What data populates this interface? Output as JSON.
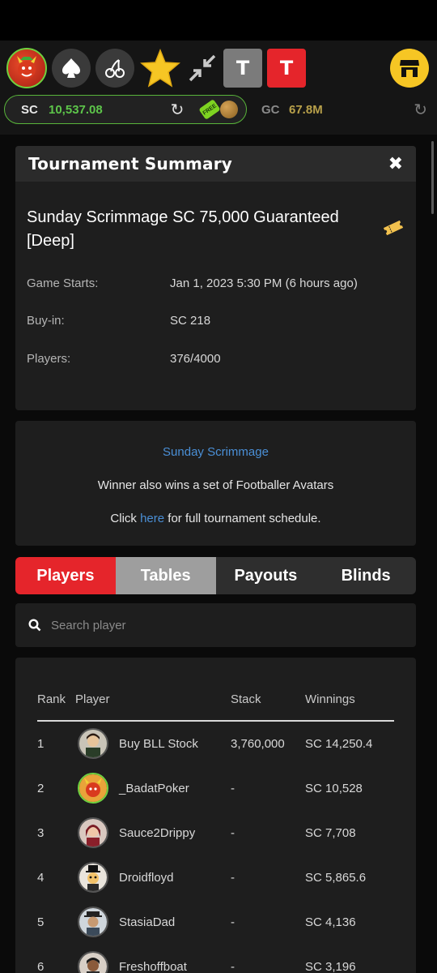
{
  "header": {
    "icons": [
      "devil-avatar-icon",
      "spade-icon",
      "cherry-icon",
      "star-icon",
      "collapse-arrows-icon",
      "table-t-icon",
      "table-t-icon",
      "shop-icon"
    ],
    "t_gray_label": "T",
    "t_red_label": "T",
    "sc_label": "SC",
    "sc_value": "10,537.08",
    "free_tag": "FREE",
    "gc_label": "GC",
    "gc_value": "67.8M",
    "colors": {
      "sc_accent": "#5dc54a",
      "red": "#e5252b",
      "gold": "#f6c624"
    }
  },
  "summary": {
    "title": "Tournament Summary",
    "tournament_name": "Sunday Scrimmage SC 75,000 Guaranteed [Deep]",
    "rows": [
      {
        "label": "Game Starts:",
        "value": "Jan 1, 2023 5:30 PM (6 hours ago)"
      },
      {
        "label": "Buy-in:",
        "value": "SC 218"
      },
      {
        "label": "Players:",
        "value": "376/4000"
      }
    ]
  },
  "promo": {
    "link_text": "Sunday Scrimmage",
    "line2": "Winner also wins a set of Footballer Avatars",
    "line3_prefix": "Click ",
    "line3_link": "here",
    "line3_suffix": " for full tournament schedule."
  },
  "tabs": [
    "Players",
    "Tables",
    "Payouts",
    "Blinds"
  ],
  "search": {
    "placeholder": "Search player"
  },
  "players_table": {
    "headers": [
      "Rank",
      "Player",
      "Stack",
      "Winnings"
    ],
    "rows": [
      {
        "rank": "1",
        "name": "Buy BLL Stock",
        "stack": "3,760,000",
        "winnings": "SC 14,250.4"
      },
      {
        "rank": "2",
        "name": "_BadatPoker",
        "stack": "-",
        "winnings": "SC 10,528"
      },
      {
        "rank": "3",
        "name": "Sauce2Drippy",
        "stack": "-",
        "winnings": "SC 7,708"
      },
      {
        "rank": "4",
        "name": "Droidfloyd",
        "stack": "-",
        "winnings": "SC 5,865.6"
      },
      {
        "rank": "5",
        "name": "StasiaDad",
        "stack": "-",
        "winnings": "SC 4,136"
      },
      {
        "rank": "6",
        "name": "Freshoffboat",
        "stack": "-",
        "winnings": "SC 3,196"
      }
    ]
  }
}
